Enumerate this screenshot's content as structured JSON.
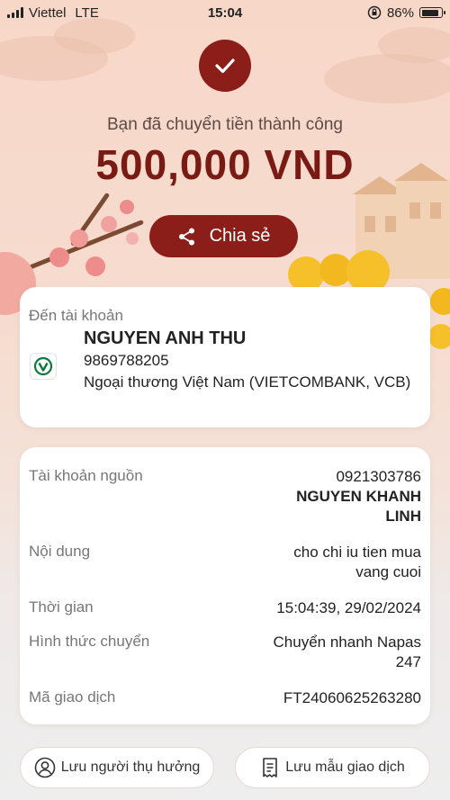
{
  "status_bar": {
    "carrier": "Viettel",
    "network": "LTE",
    "time": "15:04",
    "battery": "86%",
    "battery_level": 0.86
  },
  "result": {
    "message": "Bạn đã chuyển tiền thành công",
    "amount": "500,000 VND",
    "share_label": "Chia sẻ"
  },
  "recipient": {
    "title": "Đến tài khoản",
    "name": "NGUYEN ANH THU",
    "account": "9869788205",
    "bank": "Ngoại thương Việt Nam (VIETCOMBANK, VCB)"
  },
  "details": [
    {
      "label": "Tài khoản nguồn",
      "value_lines": [
        "0921303786"
      ],
      "bold_lines": [
        "NGUYEN KHANH",
        "LINH"
      ]
    },
    {
      "label": "Nội dung",
      "value_lines": [
        "cho chi iu tien mua",
        "vang cuoi"
      ],
      "bold_lines": []
    },
    {
      "label": "Thời gian",
      "value_lines": [
        "15:04:39, 29/02/2024"
      ],
      "bold_lines": []
    },
    {
      "label": "Hình thức chuyển",
      "value_lines": [
        "Chuyển nhanh Napas",
        "247"
      ],
      "bold_lines": []
    },
    {
      "label": "Mã giao dịch",
      "value_lines": [
        "FT24060625263280"
      ],
      "bold_lines": []
    }
  ],
  "actions": {
    "save_beneficiary": "Lưu người thụ hưởng",
    "save_template": "Lưu mẫu giao dịch"
  },
  "colors": {
    "brand": "#8b1e18",
    "amount": "#7a1a14",
    "bank_logo": "#0a7a3c"
  }
}
